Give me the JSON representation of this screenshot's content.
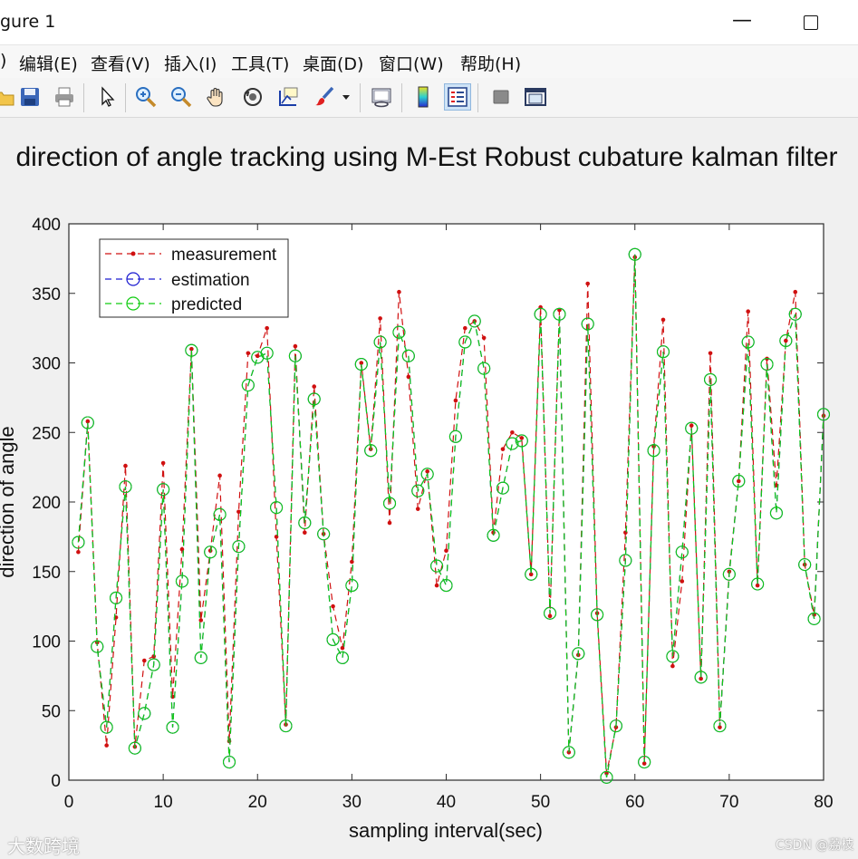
{
  "window": {
    "title": "gure 1",
    "minimize_glyph": "—",
    "maximize_glyph": ""
  },
  "menu": [
    {
      "label": ")"
    },
    {
      "label": "编辑(E)"
    },
    {
      "label": "查看(V)"
    },
    {
      "label": "插入(I)"
    },
    {
      "label": "工具(T)"
    },
    {
      "label": "桌面(D)"
    },
    {
      "label": "窗口(W)"
    },
    {
      "label": "帮助(H)"
    }
  ],
  "toolbar": {
    "icons": [
      "open-file-icon",
      "save-icon",
      "print-icon",
      "arrow-select-icon",
      "zoom-in-icon",
      "zoom-out-icon",
      "pan-hand-icon",
      "rotate-3d-icon",
      "data-cursor-icon",
      "brush-icon",
      "dropdown-arrow-icon",
      "link-plot-icon",
      "colorbar-icon",
      "legend-icon",
      "hide-plot-tools-icon",
      "show-plot-tools-icon"
    ]
  },
  "colors": {
    "measurement": "#d01010",
    "estimation": "#1a1ad0",
    "predicted": "#10cc10",
    "axes_bg": "#ffffff",
    "figure_bg": "#f0f0f0"
  },
  "watermarks": {
    "left": "大数跨境",
    "right": "CSDN @荔枝"
  },
  "chart_data": {
    "type": "line",
    "title": "direction of angle tracking using M-Est Robust cubature kalman filter",
    "xlabel": "sampling interval(sec)",
    "ylabel": "direction of angle",
    "xlim": [
      0,
      80
    ],
    "ylim": [
      0,
      400
    ],
    "xticks": [
      0,
      10,
      20,
      30,
      40,
      50,
      60,
      70,
      80
    ],
    "yticks": [
      0,
      50,
      100,
      150,
      200,
      250,
      300,
      350,
      400
    ],
    "grid": false,
    "legend_position": "top-left",
    "x": [
      1,
      2,
      3,
      4,
      5,
      6,
      7,
      8,
      9,
      10,
      11,
      12,
      13,
      14,
      15,
      16,
      17,
      18,
      19,
      20,
      21,
      22,
      23,
      24,
      25,
      26,
      27,
      28,
      29,
      30,
      31,
      32,
      33,
      34,
      35,
      36,
      37,
      38,
      39,
      40,
      41,
      42,
      43,
      44,
      45,
      46,
      47,
      48,
      49,
      50,
      51,
      52,
      53,
      54,
      55,
      56,
      57,
      58,
      59,
      60,
      61,
      62,
      63,
      64,
      65,
      66,
      67,
      68,
      69,
      70,
      71,
      72,
      73,
      74,
      75,
      76,
      77,
      78,
      79,
      80
    ],
    "series": [
      {
        "name": "measurement",
        "marker": "dot",
        "line": "dashed",
        "values": [
          164,
          258,
          99,
          25,
          117,
          226,
          24,
          86,
          89,
          228,
          60,
          166,
          310,
          115,
          165,
          219,
          28,
          193,
          307,
          305,
          325,
          175,
          40,
          312,
          178,
          283,
          177,
          125,
          95,
          157,
          300,
          238,
          332,
          185,
          351,
          290,
          195,
          222,
          140,
          165,
          273,
          325,
          330,
          318,
          178,
          238,
          250,
          246,
          148,
          340,
          118,
          338,
          20,
          90,
          357,
          120,
          5,
          38,
          178,
          376,
          12,
          240,
          331,
          82,
          143,
          255,
          73,
          307,
          38,
          150,
          215,
          337,
          140,
          303,
          212,
          316,
          351,
          155,
          119,
          262
        ]
      },
      {
        "name": "estimation",
        "marker": "circle",
        "line": "dashed",
        "values": [
          171,
          257,
          96,
          38,
          131,
          211,
          23,
          48,
          83,
          209,
          38,
          143,
          309,
          88,
          164,
          191,
          13,
          168,
          284,
          304,
          307,
          196,
          39,
          305,
          185,
          274,
          177,
          101,
          88,
          140,
          299,
          237,
          315,
          199,
          322,
          305,
          208,
          220,
          154,
          140,
          247,
          315,
          330,
          296,
          176,
          210,
          242,
          244,
          148,
          335,
          120,
          335,
          20,
          91,
          328,
          119,
          2,
          39,
          158,
          378,
          13,
          237,
          308,
          89,
          164,
          253,
          74,
          288,
          39,
          148,
          215,
          315,
          141,
          299,
          192,
          316,
          335,
          155,
          116,
          263
        ]
      },
      {
        "name": "predicted",
        "marker": "circle",
        "line": "dashed",
        "values": [
          171,
          257,
          96,
          38,
          131,
          211,
          23,
          48,
          83,
          209,
          38,
          143,
          309,
          88,
          164,
          191,
          13,
          168,
          284,
          304,
          307,
          196,
          39,
          305,
          185,
          274,
          177,
          101,
          88,
          140,
          299,
          237,
          315,
          199,
          322,
          305,
          208,
          220,
          154,
          140,
          247,
          315,
          330,
          296,
          176,
          210,
          242,
          244,
          148,
          335,
          120,
          335,
          20,
          91,
          328,
          119,
          2,
          39,
          158,
          378,
          13,
          237,
          308,
          89,
          164,
          253,
          74,
          288,
          39,
          148,
          215,
          315,
          141,
          299,
          192,
          316,
          335,
          155,
          116,
          263
        ]
      }
    ]
  }
}
